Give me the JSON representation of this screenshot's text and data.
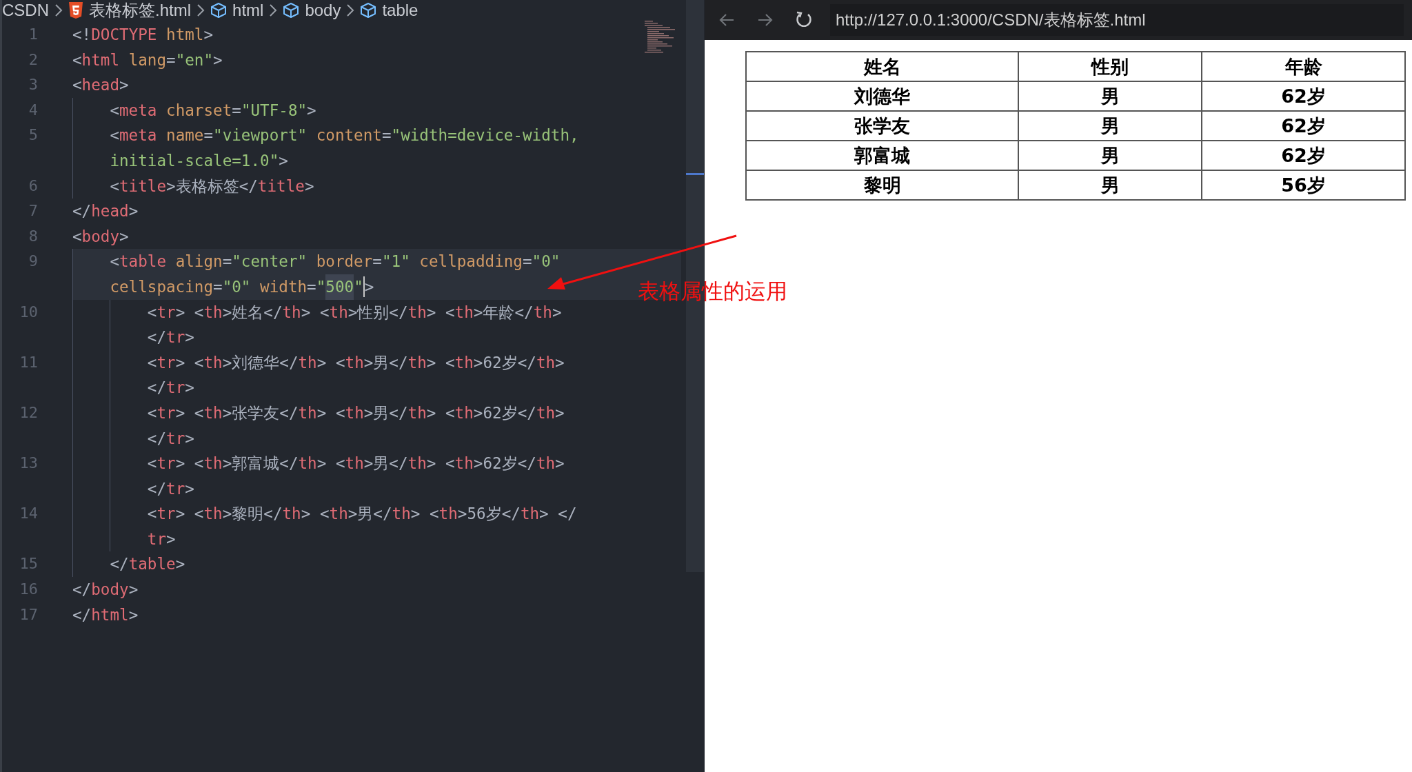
{
  "editor": {
    "breadcrumb": [
      {
        "kind": "folder",
        "label": "CSDN"
      },
      {
        "kind": "html5",
        "label": "表格标签.html"
      },
      {
        "kind": "element",
        "label": "html"
      },
      {
        "kind": "element",
        "label": "body"
      },
      {
        "kind": "element",
        "label": "table"
      }
    ],
    "lines": [
      {
        "number": "1",
        "current": false,
        "rows": [
          {
            "tokens": [
              {
                "kind": "punct",
                "text": "<!"
              },
              {
                "kind": "tag",
                "text": "DOCTYPE"
              },
              {
                "kind": "attr",
                "text": " html"
              },
              {
                "kind": "punct",
                "text": ">"
              }
            ]
          }
        ]
      },
      {
        "number": "2",
        "current": false,
        "rows": [
          {
            "tokens": [
              {
                "kind": "punct",
                "text": "<"
              },
              {
                "kind": "tag",
                "text": "html"
              },
              {
                "kind": "attr",
                "text": " lang"
              },
              {
                "kind": "punct",
                "text": "="
              },
              {
                "kind": "string",
                "text": "\"en\""
              },
              {
                "kind": "punct",
                "text": ">"
              }
            ]
          }
        ]
      },
      {
        "number": "3",
        "current": false,
        "rows": [
          {
            "tokens": [
              {
                "kind": "punct",
                "text": "<"
              },
              {
                "kind": "tag",
                "text": "head"
              },
              {
                "kind": "punct",
                "text": ">"
              }
            ]
          }
        ]
      },
      {
        "number": "4",
        "current": false,
        "rows": [
          {
            "tokens": [
              {
                "kind": "indent"
              },
              {
                "kind": "punct",
                "text": "<"
              },
              {
                "kind": "tag",
                "text": "meta"
              },
              {
                "kind": "attr",
                "text": " charset"
              },
              {
                "kind": "punct",
                "text": "="
              },
              {
                "kind": "string",
                "text": "\"UTF-8\""
              },
              {
                "kind": "punct",
                "text": ">"
              }
            ]
          }
        ]
      },
      {
        "number": "5",
        "current": false,
        "rows": [
          {
            "tokens": [
              {
                "kind": "indent"
              },
              {
                "kind": "punct",
                "text": "<"
              },
              {
                "kind": "tag",
                "text": "meta"
              },
              {
                "kind": "attr",
                "text": " name"
              },
              {
                "kind": "punct",
                "text": "="
              },
              {
                "kind": "string",
                "text": "\"viewport\""
              },
              {
                "kind": "attr",
                "text": " content"
              },
              {
                "kind": "punct",
                "text": "="
              },
              {
                "kind": "string",
                "text": "\"width=device-width,"
              }
            ]
          },
          {
            "tokens": [
              {
                "kind": "indent"
              },
              {
                "kind": "string",
                "text": "initial-scale=1.0\""
              },
              {
                "kind": "punct",
                "text": ">"
              }
            ]
          }
        ]
      },
      {
        "number": "6",
        "current": false,
        "rows": [
          {
            "tokens": [
              {
                "kind": "indent"
              },
              {
                "kind": "punct",
                "text": "<"
              },
              {
                "kind": "tag",
                "text": "title"
              },
              {
                "kind": "punct",
                "text": ">"
              },
              {
                "kind": "text",
                "text": "表格标签"
              },
              {
                "kind": "punct",
                "text": "</"
              },
              {
                "kind": "tag",
                "text": "title"
              },
              {
                "kind": "punct",
                "text": ">"
              }
            ]
          }
        ]
      },
      {
        "number": "7",
        "current": false,
        "rows": [
          {
            "tokens": [
              {
                "kind": "punct",
                "text": "</"
              },
              {
                "kind": "tag",
                "text": "head"
              },
              {
                "kind": "punct",
                "text": ">"
              }
            ]
          }
        ]
      },
      {
        "number": "8",
        "current": false,
        "rows": [
          {
            "tokens": [
              {
                "kind": "punct",
                "text": "<"
              },
              {
                "kind": "tag",
                "text": "body"
              },
              {
                "kind": "punct",
                "text": ">"
              }
            ]
          }
        ]
      },
      {
        "number": "9",
        "current": true,
        "rows": [
          {
            "tokens": [
              {
                "kind": "indent"
              },
              {
                "kind": "punct",
                "text": "<"
              },
              {
                "kind": "tag",
                "text": "table"
              },
              {
                "kind": "attr",
                "text": " align"
              },
              {
                "kind": "punct",
                "text": "="
              },
              {
                "kind": "string",
                "text": "\"center\""
              },
              {
                "kind": "attr",
                "text": " border"
              },
              {
                "kind": "punct",
                "text": "="
              },
              {
                "kind": "string",
                "text": "\"1\""
              },
              {
                "kind": "attr",
                "text": " cellpadding"
              },
              {
                "kind": "punct",
                "text": "="
              },
              {
                "kind": "string",
                "text": "\"0\""
              }
            ]
          },
          {
            "tokens": [
              {
                "kind": "indent"
              },
              {
                "kind": "attr",
                "text": "cellspacing"
              },
              {
                "kind": "punct",
                "text": "="
              },
              {
                "kind": "string",
                "text": "\"0\""
              },
              {
                "kind": "attr",
                "text": " width"
              },
              {
                "kind": "punct",
                "text": "="
              },
              {
                "kind": "string",
                "text": "\""
              },
              {
                "kind": "match",
                "text": "500"
              },
              {
                "kind": "string",
                "text": "\""
              },
              {
                "kind": "cursor"
              },
              {
                "kind": "punct",
                "text": ">"
              }
            ]
          }
        ]
      },
      {
        "number": "10",
        "current": false,
        "rows": [
          {
            "tokens": [
              {
                "kind": "indent"
              },
              {
                "kind": "indent"
              },
              {
                "kind": "punct",
                "text": "<"
              },
              {
                "kind": "tag",
                "text": "tr"
              },
              {
                "kind": "punct",
                "text": "> <"
              },
              {
                "kind": "tag",
                "text": "th"
              },
              {
                "kind": "punct",
                "text": ">"
              },
              {
                "kind": "text",
                "text": "姓名"
              },
              {
                "kind": "punct",
                "text": "</"
              },
              {
                "kind": "tag",
                "text": "th"
              },
              {
                "kind": "punct",
                "text": "> <"
              },
              {
                "kind": "tag",
                "text": "th"
              },
              {
                "kind": "punct",
                "text": ">"
              },
              {
                "kind": "text",
                "text": "性别"
              },
              {
                "kind": "punct",
                "text": "</"
              },
              {
                "kind": "tag",
                "text": "th"
              },
              {
                "kind": "punct",
                "text": "> <"
              },
              {
                "kind": "tag",
                "text": "th"
              },
              {
                "kind": "punct",
                "text": ">"
              },
              {
                "kind": "text",
                "text": "年龄"
              },
              {
                "kind": "punct",
                "text": "</"
              },
              {
                "kind": "tag",
                "text": "th"
              },
              {
                "kind": "punct",
                "text": ">"
              }
            ]
          },
          {
            "tokens": [
              {
                "kind": "indent"
              },
              {
                "kind": "indent"
              },
              {
                "kind": "punct",
                "text": "</"
              },
              {
                "kind": "tag",
                "text": "tr"
              },
              {
                "kind": "punct",
                "text": ">"
              }
            ]
          }
        ]
      },
      {
        "number": "11",
        "current": false,
        "rows": [
          {
            "tokens": [
              {
                "kind": "indent"
              },
              {
                "kind": "indent"
              },
              {
                "kind": "punct",
                "text": "<"
              },
              {
                "kind": "tag",
                "text": "tr"
              },
              {
                "kind": "punct",
                "text": "> <"
              },
              {
                "kind": "tag",
                "text": "th"
              },
              {
                "kind": "punct",
                "text": ">"
              },
              {
                "kind": "text",
                "text": "刘德华"
              },
              {
                "kind": "punct",
                "text": "</"
              },
              {
                "kind": "tag",
                "text": "th"
              },
              {
                "kind": "punct",
                "text": "> <"
              },
              {
                "kind": "tag",
                "text": "th"
              },
              {
                "kind": "punct",
                "text": ">"
              },
              {
                "kind": "text",
                "text": "男"
              },
              {
                "kind": "punct",
                "text": "</"
              },
              {
                "kind": "tag",
                "text": "th"
              },
              {
                "kind": "punct",
                "text": "> <"
              },
              {
                "kind": "tag",
                "text": "th"
              },
              {
                "kind": "punct",
                "text": ">"
              },
              {
                "kind": "text",
                "text": "62岁"
              },
              {
                "kind": "punct",
                "text": "</"
              },
              {
                "kind": "tag",
                "text": "th"
              },
              {
                "kind": "punct",
                "text": ">"
              }
            ]
          },
          {
            "tokens": [
              {
                "kind": "indent"
              },
              {
                "kind": "indent"
              },
              {
                "kind": "punct",
                "text": "</"
              },
              {
                "kind": "tag",
                "text": "tr"
              },
              {
                "kind": "punct",
                "text": ">"
              }
            ]
          }
        ]
      },
      {
        "number": "12",
        "current": false,
        "rows": [
          {
            "tokens": [
              {
                "kind": "indent"
              },
              {
                "kind": "indent"
              },
              {
                "kind": "punct",
                "text": "<"
              },
              {
                "kind": "tag",
                "text": "tr"
              },
              {
                "kind": "punct",
                "text": "> <"
              },
              {
                "kind": "tag",
                "text": "th"
              },
              {
                "kind": "punct",
                "text": ">"
              },
              {
                "kind": "text",
                "text": "张学友"
              },
              {
                "kind": "punct",
                "text": "</"
              },
              {
                "kind": "tag",
                "text": "th"
              },
              {
                "kind": "punct",
                "text": "> <"
              },
              {
                "kind": "tag",
                "text": "th"
              },
              {
                "kind": "punct",
                "text": ">"
              },
              {
                "kind": "text",
                "text": "男"
              },
              {
                "kind": "punct",
                "text": "</"
              },
              {
                "kind": "tag",
                "text": "th"
              },
              {
                "kind": "punct",
                "text": "> <"
              },
              {
                "kind": "tag",
                "text": "th"
              },
              {
                "kind": "punct",
                "text": ">"
              },
              {
                "kind": "text",
                "text": "62岁"
              },
              {
                "kind": "punct",
                "text": "</"
              },
              {
                "kind": "tag",
                "text": "th"
              },
              {
                "kind": "punct",
                "text": ">"
              }
            ]
          },
          {
            "tokens": [
              {
                "kind": "indent"
              },
              {
                "kind": "indent"
              },
              {
                "kind": "punct",
                "text": "</"
              },
              {
                "kind": "tag",
                "text": "tr"
              },
              {
                "kind": "punct",
                "text": ">"
              }
            ]
          }
        ]
      },
      {
        "number": "13",
        "current": false,
        "rows": [
          {
            "tokens": [
              {
                "kind": "indent"
              },
              {
                "kind": "indent"
              },
              {
                "kind": "punct",
                "text": "<"
              },
              {
                "kind": "tag",
                "text": "tr"
              },
              {
                "kind": "punct",
                "text": "> <"
              },
              {
                "kind": "tag",
                "text": "th"
              },
              {
                "kind": "punct",
                "text": ">"
              },
              {
                "kind": "text",
                "text": "郭富城"
              },
              {
                "kind": "punct",
                "text": "</"
              },
              {
                "kind": "tag",
                "text": "th"
              },
              {
                "kind": "punct",
                "text": "> <"
              },
              {
                "kind": "tag",
                "text": "th"
              },
              {
                "kind": "punct",
                "text": ">"
              },
              {
                "kind": "text",
                "text": "男"
              },
              {
                "kind": "punct",
                "text": "</"
              },
              {
                "kind": "tag",
                "text": "th"
              },
              {
                "kind": "punct",
                "text": "> <"
              },
              {
                "kind": "tag",
                "text": "th"
              },
              {
                "kind": "punct",
                "text": ">"
              },
              {
                "kind": "text",
                "text": "62岁"
              },
              {
                "kind": "punct",
                "text": "</"
              },
              {
                "kind": "tag",
                "text": "th"
              },
              {
                "kind": "punct",
                "text": ">"
              }
            ]
          },
          {
            "tokens": [
              {
                "kind": "indent"
              },
              {
                "kind": "indent"
              },
              {
                "kind": "punct",
                "text": "</"
              },
              {
                "kind": "tag",
                "text": "tr"
              },
              {
                "kind": "punct",
                "text": ">"
              }
            ]
          }
        ]
      },
      {
        "number": "14",
        "current": false,
        "rows": [
          {
            "tokens": [
              {
                "kind": "indent"
              },
              {
                "kind": "indent"
              },
              {
                "kind": "punct",
                "text": "<"
              },
              {
                "kind": "tag",
                "text": "tr"
              },
              {
                "kind": "punct",
                "text": "> <"
              },
              {
                "kind": "tag",
                "text": "th"
              },
              {
                "kind": "punct",
                "text": ">"
              },
              {
                "kind": "text",
                "text": "黎明"
              },
              {
                "kind": "punct",
                "text": "</"
              },
              {
                "kind": "tag",
                "text": "th"
              },
              {
                "kind": "punct",
                "text": "> <"
              },
              {
                "kind": "tag",
                "text": "th"
              },
              {
                "kind": "punct",
                "text": ">"
              },
              {
                "kind": "text",
                "text": "男"
              },
              {
                "kind": "punct",
                "text": "</"
              },
              {
                "kind": "tag",
                "text": "th"
              },
              {
                "kind": "punct",
                "text": "> <"
              },
              {
                "kind": "tag",
                "text": "th"
              },
              {
                "kind": "punct",
                "text": ">"
              },
              {
                "kind": "text",
                "text": "56岁"
              },
              {
                "kind": "punct",
                "text": "</"
              },
              {
                "kind": "tag",
                "text": "th"
              },
              {
                "kind": "punct",
                "text": "> </"
              }
            ]
          },
          {
            "tokens": [
              {
                "kind": "indent"
              },
              {
                "kind": "indent"
              },
              {
                "kind": "tag",
                "text": "tr"
              },
              {
                "kind": "punct",
                "text": ">"
              }
            ]
          }
        ]
      },
      {
        "number": "15",
        "current": false,
        "rows": [
          {
            "tokens": [
              {
                "kind": "indent"
              },
              {
                "kind": "punct",
                "text": "</"
              },
              {
                "kind": "tag",
                "text": "table"
              },
              {
                "kind": "punct",
                "text": ">"
              }
            ]
          }
        ]
      },
      {
        "number": "16",
        "current": false,
        "rows": [
          {
            "tokens": [
              {
                "kind": "punct",
                "text": "</"
              },
              {
                "kind": "tag",
                "text": "body"
              },
              {
                "kind": "punct",
                "text": ">"
              }
            ]
          }
        ]
      },
      {
        "number": "17",
        "current": false,
        "rows": [
          {
            "tokens": [
              {
                "kind": "punct",
                "text": "</"
              },
              {
                "kind": "tag",
                "text": "html"
              },
              {
                "kind": "punct",
                "text": ">"
              }
            ]
          }
        ]
      }
    ]
  },
  "browser": {
    "back": {
      "disabled": true
    },
    "forward": {
      "disabled": true
    },
    "url": "http://127.0.0.1:3000/CSDN/表格标签.html",
    "table": {
      "columns": [
        "姓名",
        "性别",
        "年龄"
      ],
      "rows": [
        [
          "刘德华",
          "男",
          "62岁"
        ],
        [
          "张学友",
          "男",
          "62岁"
        ],
        [
          "郭富城",
          "男",
          "62岁"
        ],
        [
          "黎明",
          "男",
          "56岁"
        ]
      ]
    }
  },
  "annotation": {
    "text": "表格属性的运用"
  }
}
